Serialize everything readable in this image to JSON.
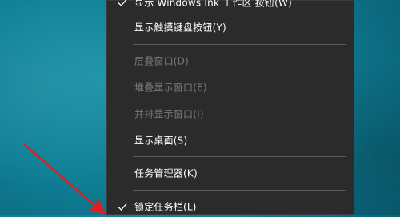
{
  "menu": {
    "items": [
      {
        "label": "显示 Windows Ink 工作区 按钮(W)",
        "checked": true,
        "disabled": false
      },
      {
        "label": "显示触摸键盘按钮(Y)",
        "checked": false,
        "disabled": false
      },
      {
        "label": "层叠窗口(D)",
        "checked": false,
        "disabled": true
      },
      {
        "label": "堆叠显示窗口(E)",
        "checked": false,
        "disabled": true
      },
      {
        "label": "并排显示窗口(I)",
        "checked": false,
        "disabled": true
      },
      {
        "label": "显示桌面(S)",
        "checked": false,
        "disabled": false
      },
      {
        "label": "任务管理器(K)",
        "checked": false,
        "disabled": false
      },
      {
        "label": "锁定任务栏(L)",
        "checked": true,
        "disabled": false
      }
    ]
  },
  "colors": {
    "menu_bg": "#2b2b2b",
    "text": "#ffffff",
    "disabled_text": "#7a7a7a",
    "separator": "#5a5a5a",
    "arrow": "#e01e1e"
  }
}
